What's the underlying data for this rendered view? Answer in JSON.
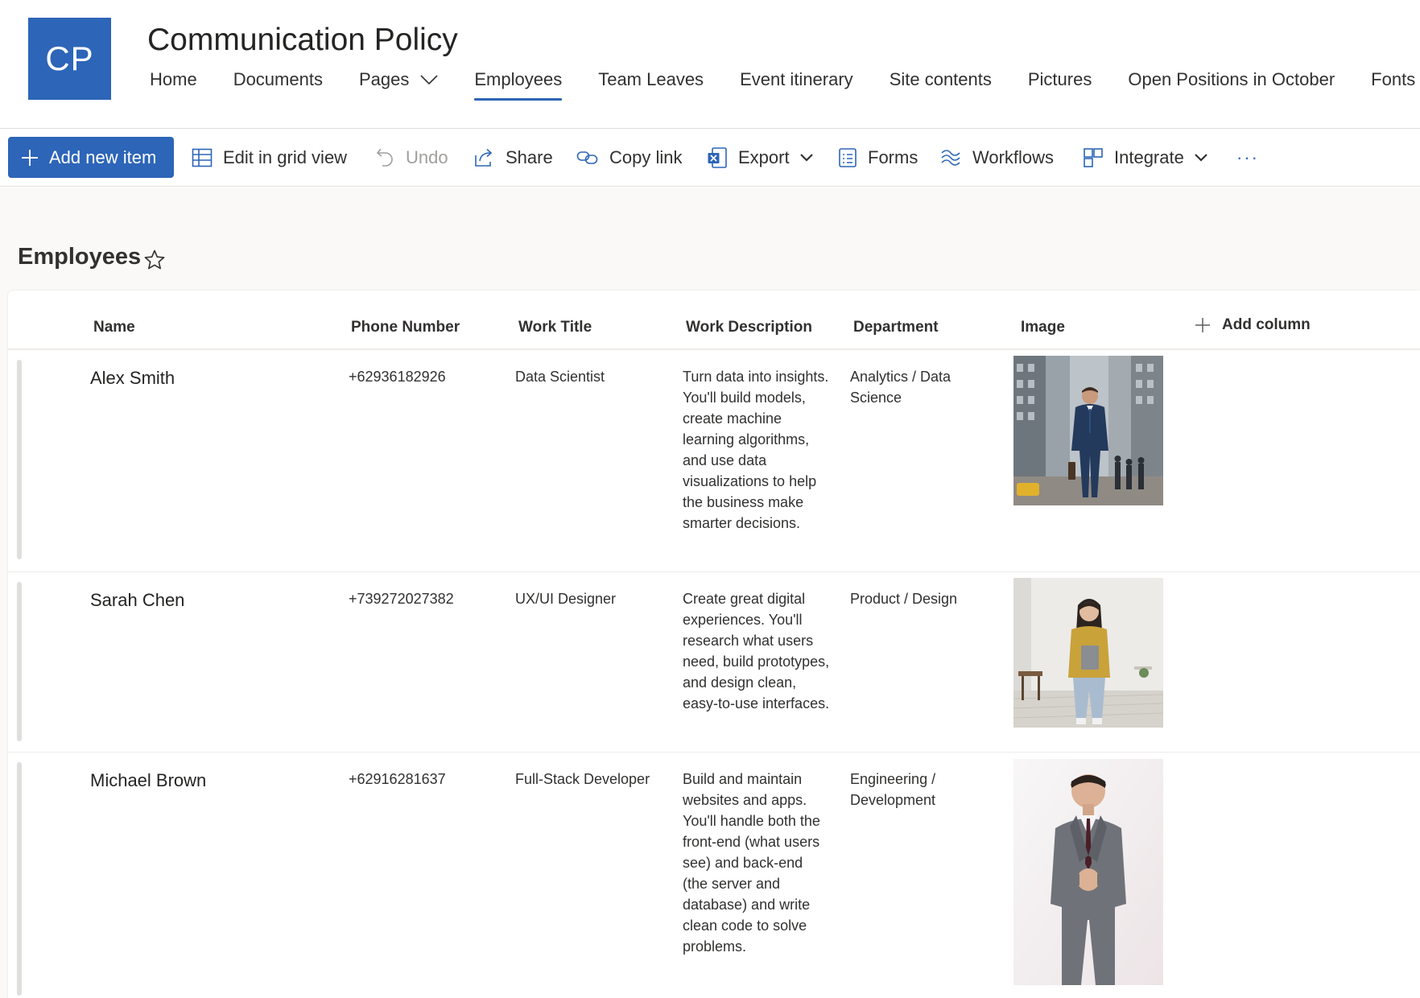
{
  "site": {
    "logo_initials": "CP",
    "title": "Communication Policy",
    "brand_color": "#2d65b8",
    "nav": [
      {
        "label": "Home",
        "active": false
      },
      {
        "label": "Documents",
        "active": false
      },
      {
        "label": "Pages",
        "active": false,
        "has_dropdown": true
      },
      {
        "label": "Employees",
        "active": true
      },
      {
        "label": "Team Leaves",
        "active": false
      },
      {
        "label": "Event itinerary",
        "active": false
      },
      {
        "label": "Site contents",
        "active": false
      },
      {
        "label": "Pictures",
        "active": false
      },
      {
        "label": "Open Positions in October",
        "active": false
      },
      {
        "label": "Fonts",
        "active": false
      }
    ]
  },
  "commands": {
    "add_new_item": "Add new item",
    "edit_grid": "Edit in grid view",
    "undo": "Undo",
    "share": "Share",
    "copy_link": "Copy link",
    "export": "Export",
    "forms": "Forms",
    "workflows": "Workflows",
    "integrate": "Integrate",
    "more": "···"
  },
  "list": {
    "title": "Employees",
    "columns": {
      "name": "Name",
      "phone": "Phone Number",
      "work_title": "Work Title",
      "work_description": "Work Description",
      "department": "Department",
      "image": "Image",
      "add_column": "Add column"
    },
    "rows": [
      {
        "name": "Alex Smith",
        "phone": "+62936182926",
        "work_title": "Data Scientist",
        "work_description": "Turn data into insights. You'll build models, create machine learning algorithms, and use data visualizations to help the business make smarter decisions.",
        "department": "Analytics / Data Science",
        "image_icon": "photo-man-city-street"
      },
      {
        "name": "Sarah Chen",
        "phone": "+739272027382",
        "work_title": "UX/UI Designer",
        "work_description": "Create great digital experiences. You'll research what users need, build prototypes, and design clean, easy-to-use interfaces.",
        "department": "Product / Design",
        "image_icon": "photo-woman-office"
      },
      {
        "name": "Michael Brown",
        "phone": "+62916281637",
        "work_title": "Full-Stack Developer",
        "work_description": "Build and maintain websites and apps. You'll handle both the front-end (what users see) and back-end (the server and database) and write clean code to solve problems.",
        "department": "Engineering / Development",
        "image_icon": "photo-man-grey-suit"
      }
    ]
  }
}
